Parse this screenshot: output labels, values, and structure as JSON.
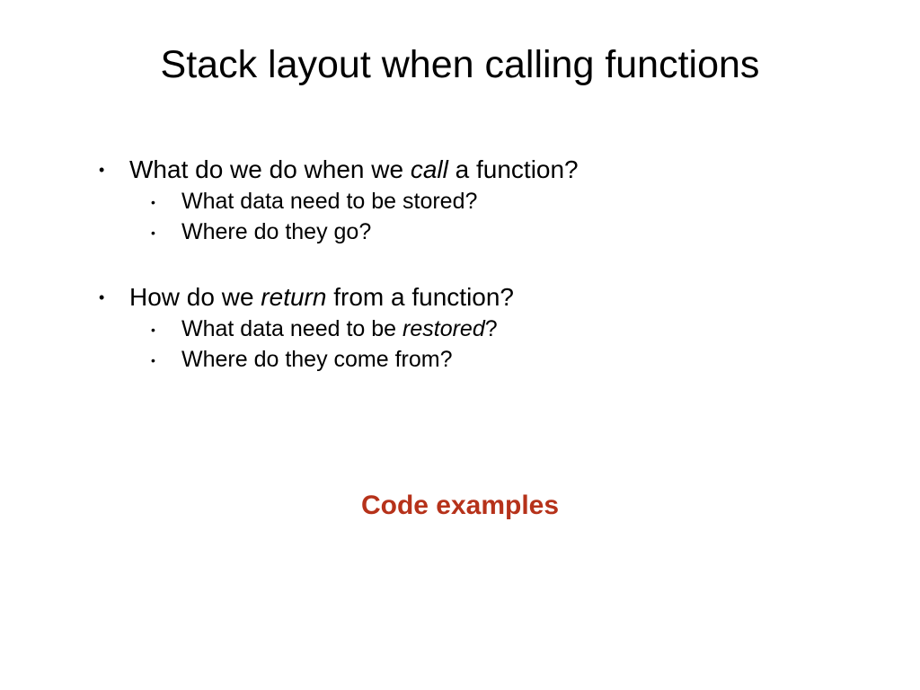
{
  "title": "Stack layout when calling functions",
  "q1": {
    "pre": "What do we do when we ",
    "em": "call",
    "post": " a function?",
    "sub1": "What data need to be stored?",
    "sub2": "Where do they go?"
  },
  "q2": {
    "pre": "How do we ",
    "em": "return",
    "post": " from a function?",
    "sub1_pre": "What data need to be ",
    "sub1_em": "restored",
    "sub1_post": "?",
    "sub2": "Where do they come from?"
  },
  "footer": "Code examples",
  "colors": {
    "accent": "#b6321a"
  }
}
